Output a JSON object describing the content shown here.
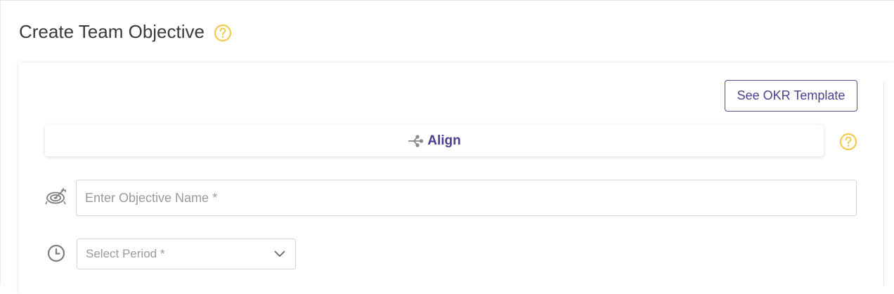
{
  "header": {
    "title": "Create Team Objective",
    "help_icon": "question-circle-icon"
  },
  "toolbar": {
    "okr_template_label": "See OKR Template"
  },
  "align": {
    "label": "Align",
    "icon": "align-branch-icon",
    "help_icon": "question-circle-icon"
  },
  "objective": {
    "placeholder": "Enter Objective Name *",
    "value": "",
    "icon": "target-icon"
  },
  "period": {
    "selected": "Select Period *",
    "icon": "clock-icon"
  },
  "colors": {
    "accent": "#4d3f92",
    "help": "#f5c94d",
    "border": "#d6d6d6",
    "placeholder": "#9a9a9a",
    "title": "#3a3a3a"
  }
}
